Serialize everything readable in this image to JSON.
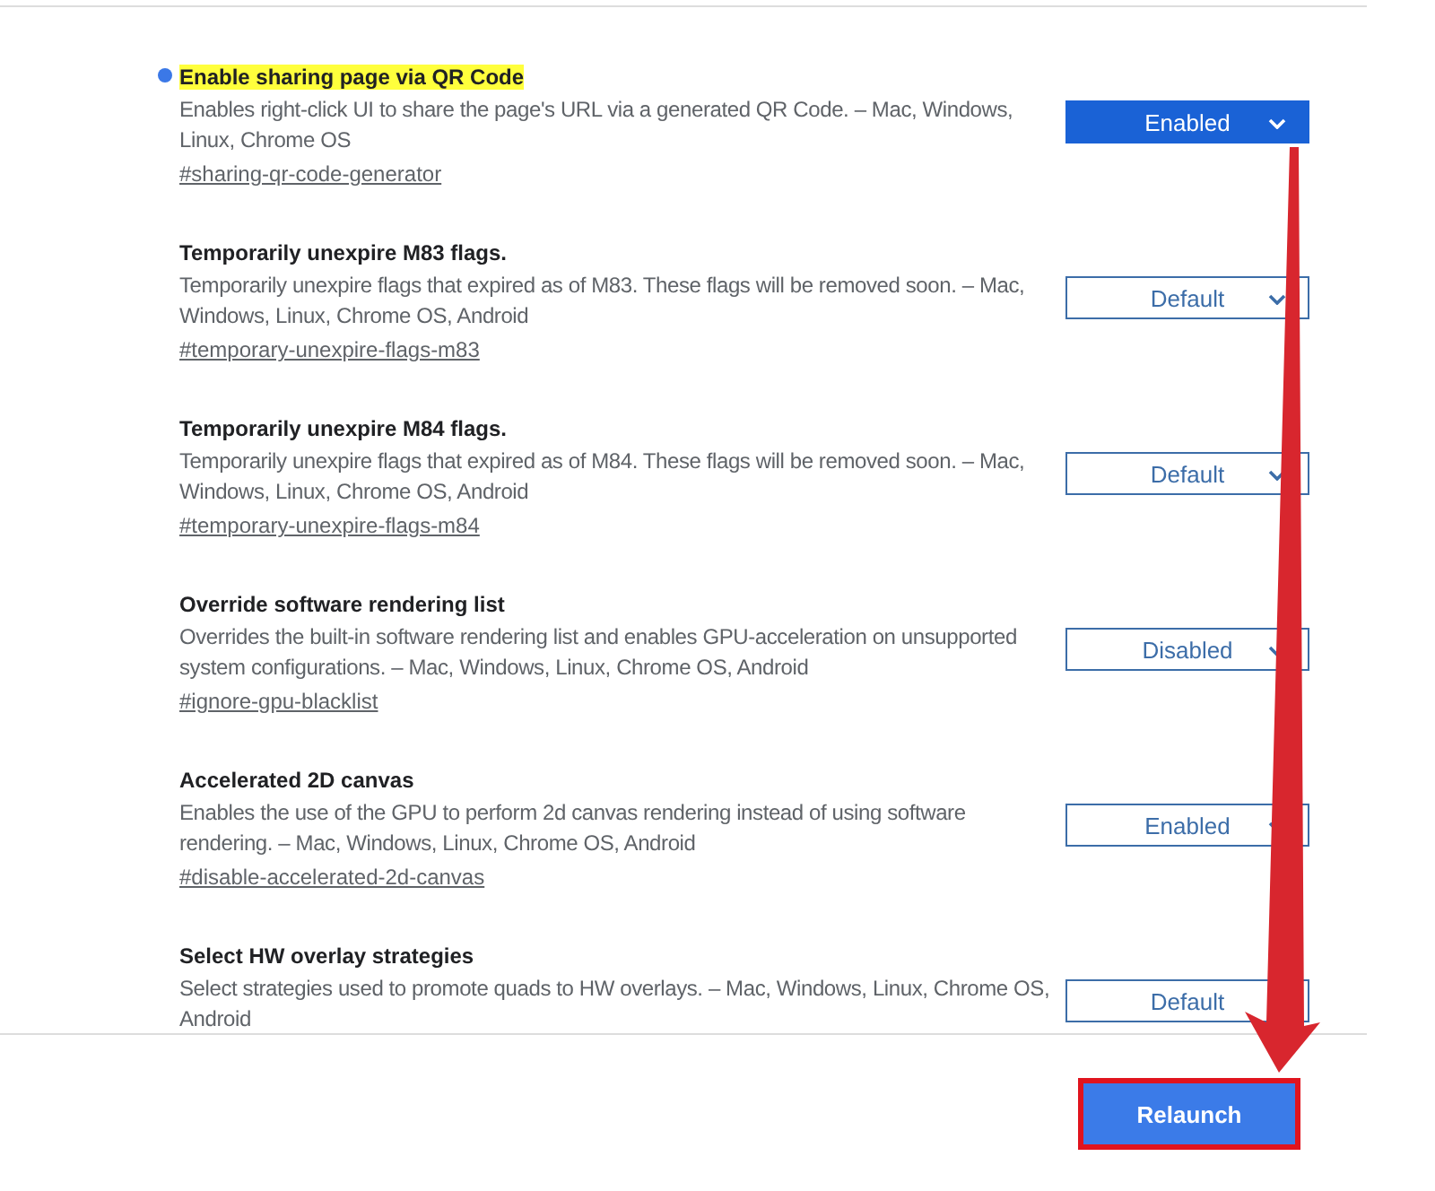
{
  "flags": [
    {
      "title": "Enable sharing page via QR Code",
      "modified": true,
      "highlighted": true,
      "description": "Enables right-click UI to share the page's URL via a generated QR Code. – Mac, Windows, Linux, Chrome OS",
      "link": "#sharing-qr-code-generator",
      "value": "Enabled"
    },
    {
      "title": "Temporarily unexpire M83 flags.",
      "modified": false,
      "highlighted": false,
      "description": "Temporarily unexpire flags that expired as of M83. These flags will be removed soon. – Mac, Windows, Linux, Chrome OS, Android",
      "link": "#temporary-unexpire-flags-m83",
      "value": "Default"
    },
    {
      "title": "Temporarily unexpire M84 flags.",
      "modified": false,
      "highlighted": false,
      "description": "Temporarily unexpire flags that expired as of M84. These flags will be removed soon. – Mac, Windows, Linux, Chrome OS, Android",
      "link": "#temporary-unexpire-flags-m84",
      "value": "Default"
    },
    {
      "title": "Override software rendering list",
      "modified": false,
      "highlighted": false,
      "description": "Overrides the built-in software rendering list and enables GPU-acceleration on unsupported system configurations. – Mac, Windows, Linux, Chrome OS, Android",
      "link": "#ignore-gpu-blacklist",
      "value": "Disabled"
    },
    {
      "title": "Accelerated 2D canvas",
      "modified": false,
      "highlighted": false,
      "description": "Enables the use of the GPU to perform 2d canvas rendering instead of using software rendering. – Mac, Windows, Linux, Chrome OS, Android",
      "link": "#disable-accelerated-2d-canvas",
      "value": "Enabled"
    },
    {
      "title": "Select HW overlay strategies",
      "modified": false,
      "highlighted": false,
      "description": "Select strategies used to promote quads to HW overlays. – Mac, Windows, Linux, Chrome OS, Android",
      "value": "Default"
    }
  ],
  "relaunch_button": "Relaunch"
}
